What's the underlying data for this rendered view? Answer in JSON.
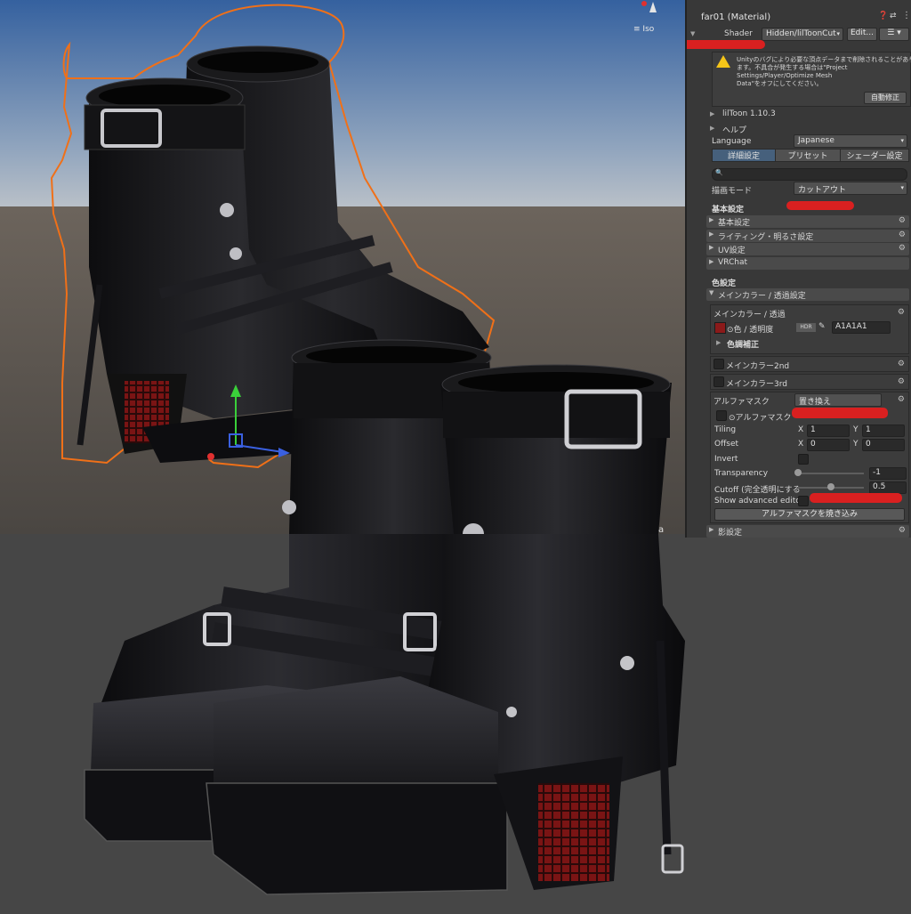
{
  "scene": {
    "view_mode": "Iso",
    "handle_label": "a"
  },
  "inspector": {
    "material_name": "far01 (Material)",
    "shader_label": "Shader",
    "shader_value": "Hidden/lilToonCut",
    "edit_button": "Edit...",
    "warning_line1": "Unityのバグにより必要な頂点データまで削除されることがあり",
    "warning_line2": "ます。不具合が発生する場合は\"Project",
    "warning_line3": "Settings/Player/Optimize Mesh",
    "warning_line4": "Data\"をオフにしてください。",
    "auto_fix_button": "自動修正",
    "version": "lilToon 1.10.3",
    "help": "ヘルプ",
    "language_label": "Language",
    "language_value": "Japanese",
    "tabs": [
      {
        "label": "詳細設定",
        "active": true
      },
      {
        "label": "プリセット",
        "active": false
      },
      {
        "label": "シェーダー設定",
        "active": false
      }
    ],
    "render_mode_label": "描画モード",
    "render_mode_value": "カットアウト",
    "basic_header": "基本設定",
    "basic_sections": [
      "基本設定",
      "ライティング・明るさ設定",
      "UV設定",
      "VRChat"
    ],
    "color_header": "色設定",
    "main_color_section": "メインカラー / 透過設定",
    "main_color_box_title": "メインカラー / 透過",
    "color_label": "色 / 透明度",
    "hdr_label": "HDR",
    "color_hex": "A1A1A1",
    "color_swatch": "#8b1a1a",
    "color_correction": "色調補正",
    "main_color_2nd": "メインカラー2nd",
    "main_color_3rd": "メインカラー3rd",
    "alpha_mask_label": "アルファマスク",
    "alpha_mask_mode": "置き換え",
    "alpha_mask_tex": "アルファマスク",
    "tiling_label": "Tiling",
    "offset_label": "Offset",
    "x_label": "X",
    "y_label": "Y",
    "tiling_x": "1",
    "tiling_y": "1",
    "offset_x": "0",
    "offset_y": "0",
    "invert_label": "Invert",
    "transparency_label": "Transparency",
    "transparency_value": "-1",
    "transparency_slider": 0.0,
    "cutoff_label": "Cutoff (完全透明にする",
    "cutoff_value": "0.5",
    "cutoff_slider": 0.5,
    "show_advanced_label": "Show advanced edito",
    "bake_button": "アルファマスクを焼き込み",
    "shadow_section": "影設定"
  },
  "colors": {
    "accent_red": "#d92020",
    "selection_outline": "#f07018"
  }
}
